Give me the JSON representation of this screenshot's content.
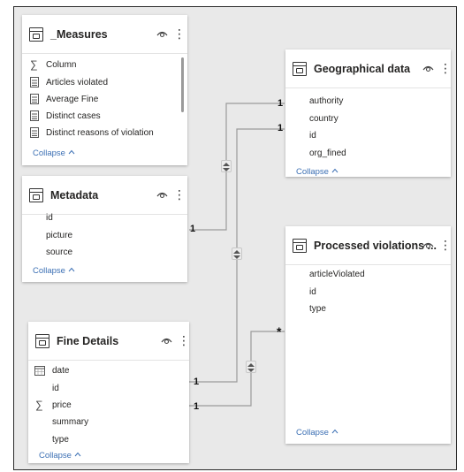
{
  "tables": {
    "measures": {
      "title": "_Measures",
      "fields": [
        "Column",
        "Articles violated",
        "Average Fine",
        "Distinct cases",
        "Distinct reasons of violation"
      ],
      "collapse_label": "Collapse"
    },
    "geographical": {
      "title": "Geographical data",
      "fields": [
        "authority",
        "country",
        "id",
        "org_fined"
      ],
      "collapse_label": "Collapse"
    },
    "metadata": {
      "title": "Metadata",
      "fields": [
        "id",
        "picture",
        "source"
      ],
      "collapse_label": "Collapse"
    },
    "processed": {
      "title": "Processed violations ...",
      "fields": [
        "articleViolated",
        "id",
        "type"
      ],
      "collapse_label": "Collapse"
    },
    "fine_details": {
      "title": "Fine Details",
      "fields": [
        "date",
        "id",
        "price",
        "summary",
        "type"
      ],
      "collapse_label": "Collapse"
    }
  },
  "relationships": {
    "geo_top": "1",
    "geo_bottom": "1",
    "metadata_side": "1",
    "processed_side": "*",
    "fine_top": "1",
    "fine_bottom": "1"
  }
}
